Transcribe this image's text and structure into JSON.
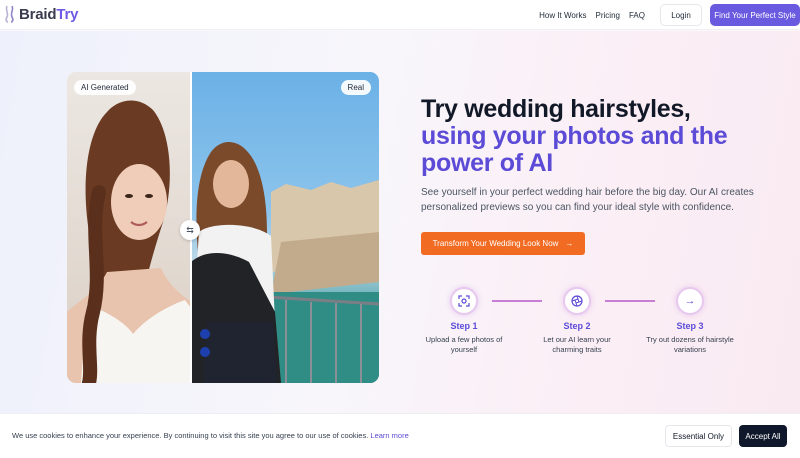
{
  "brand": {
    "name_part1": "Braid",
    "name_part2": "Try",
    "accent_color": "#6a5ae0"
  },
  "nav": {
    "links": [
      "How It Works",
      "Pricing",
      "FAQ"
    ],
    "login_label": "Login",
    "cta_label": "Find Your Perfect Style"
  },
  "comparison": {
    "left_badge": "AI Generated",
    "right_badge": "Real",
    "handle_icon": "swap-arrows-icon"
  },
  "hero": {
    "headline_line1": "Try wedding hairstyles,",
    "headline_line2": "using your photos and the power of AI",
    "subtext": "See yourself in your perfect wedding hair before the big day. Our AI creates personalized previews so you can find your ideal style with confidence.",
    "cta_label": "Transform Your Wedding Look Now",
    "cta_icon": "arrow-right-icon",
    "cta_color": "#f26b22"
  },
  "steps": [
    {
      "icon": "camera-focus-icon",
      "title": "Step 1",
      "description": "Upload a few photos of yourself"
    },
    {
      "icon": "aperture-icon",
      "title": "Step 2",
      "description": "Let our AI learn your charming traits"
    },
    {
      "icon": "arrow-right-icon",
      "title": "Step 3",
      "description": "Try out dozens of hairstyle variations"
    }
  ],
  "cookie": {
    "text": "We use cookies to enhance your experience. By continuing to visit this site you agree to our use of cookies.",
    "link_label": "Learn more",
    "essential_label": "Essential Only",
    "accept_label": "Accept All"
  }
}
